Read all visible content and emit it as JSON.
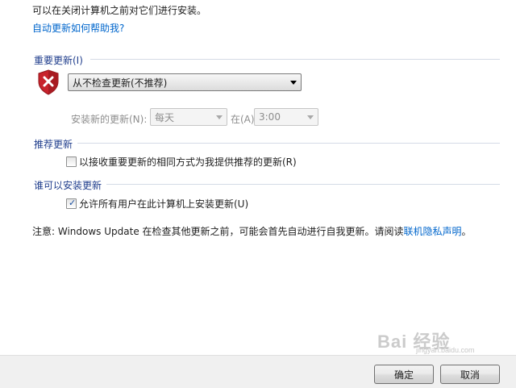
{
  "intro_text": "可以在关闭计算机之前对它们进行安装。",
  "help_link": "自动更新如何帮助我?",
  "important_updates": {
    "title": "重要更新(I)",
    "selected_option": "从不检查更新(不推荐)",
    "install_label": "安装新的更新(N):",
    "day_value": "每天",
    "at_label": "在(A)",
    "time_value": "3:00"
  },
  "recommended_updates": {
    "title": "推荐更新",
    "checkbox_label": "以接收重要更新的相同方式为我提供推荐的更新(R)",
    "checked": false
  },
  "who_can_install": {
    "title": "谁可以安装更新",
    "checkbox_label": "允许所有用户在此计算机上安装更新(U)",
    "checked": true
  },
  "note": {
    "text": "注意: Windows Update 在检查其他更新之前，可能会首先自动进行自我更新。请阅读",
    "link": "联机隐私声明",
    "suffix": "。"
  },
  "buttons": {
    "ok": "确定",
    "cancel": "取消"
  },
  "watermark": {
    "logo": "Bai 经验",
    "sub": "jingyan.baidu.com"
  },
  "colors": {
    "link": "#0066cc",
    "section_title": "#1f3d8c",
    "shield_red": "#c8232c"
  }
}
